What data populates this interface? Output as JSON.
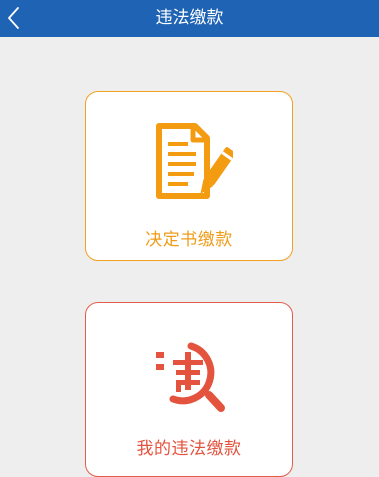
{
  "header": {
    "title": "违法缴款",
    "back_icon": "chevron-left-icon"
  },
  "cards": [
    {
      "label": "决定书缴款",
      "icon": "document-pen-icon",
      "color": "#ef9c17"
    },
    {
      "label": "我的违法缴款",
      "icon": "violation-search-icon",
      "color": "#e3533e"
    }
  ],
  "colors": {
    "nav_bg": "#1f63b4",
    "page_bg": "#eeeeee"
  }
}
